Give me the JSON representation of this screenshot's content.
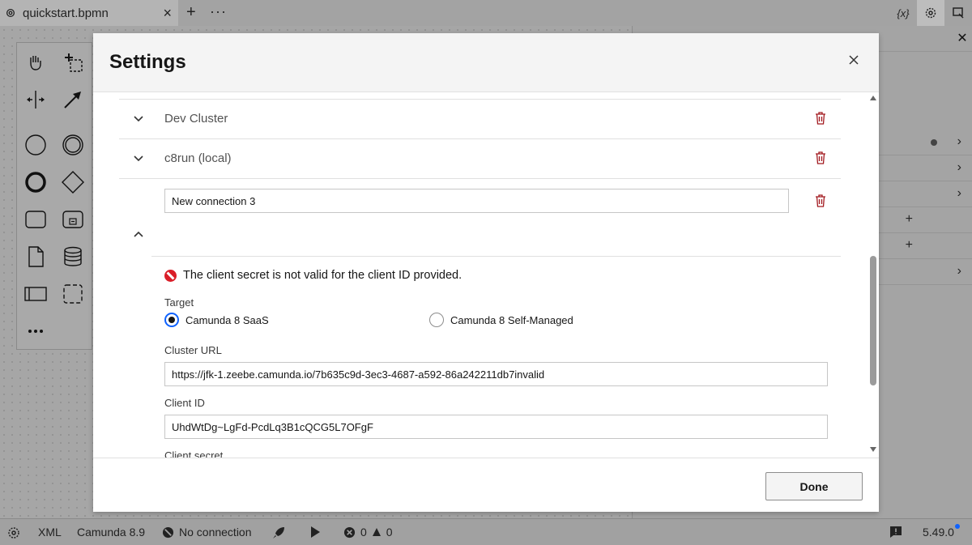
{
  "tab": {
    "filename": "quickstart.bpmn",
    "close": "×",
    "add": "+",
    "more": "···"
  },
  "toolbar_right": {
    "variables_icon": "{x}"
  },
  "statusbar": {
    "xml": "XML",
    "engine": "Camunda 8.9",
    "connection": "No connection",
    "errors": "0",
    "warnings": "0",
    "version": "5.49.0"
  },
  "modal": {
    "title": "Settings",
    "connections": [
      {
        "label": "Dev Cluster",
        "expanded": false
      },
      {
        "label": "c8run (local)",
        "expanded": false
      },
      {
        "label": "New connection 3",
        "expanded": true
      }
    ],
    "error_message": "The client secret is not valid for the client ID provided.",
    "target_label": "Target",
    "target_options": [
      {
        "label": "Camunda 8 SaaS",
        "checked": true
      },
      {
        "label": "Camunda 8 Self-Managed",
        "checked": false
      }
    ],
    "cluster_url_label": "Cluster URL",
    "cluster_url_value": "https://jfk-1.zeebe.camunda.io/7b635c9d-3ec3-4687-a592-86a242211db7invalid",
    "client_id_label": "Client ID",
    "client_id_value": "UhdWtDg~LgFd-PcdLq3B1cQCG5L7OFgF",
    "client_secret_label": "Client secret",
    "client_secret_value": "••••••••••••••••••••••••••••••••••••••••••••••••••••••••••••••",
    "done_label": "Done"
  },
  "colors": {
    "error": "#da1e28",
    "focus": "#0f62fe",
    "trash": "#a2191f"
  }
}
